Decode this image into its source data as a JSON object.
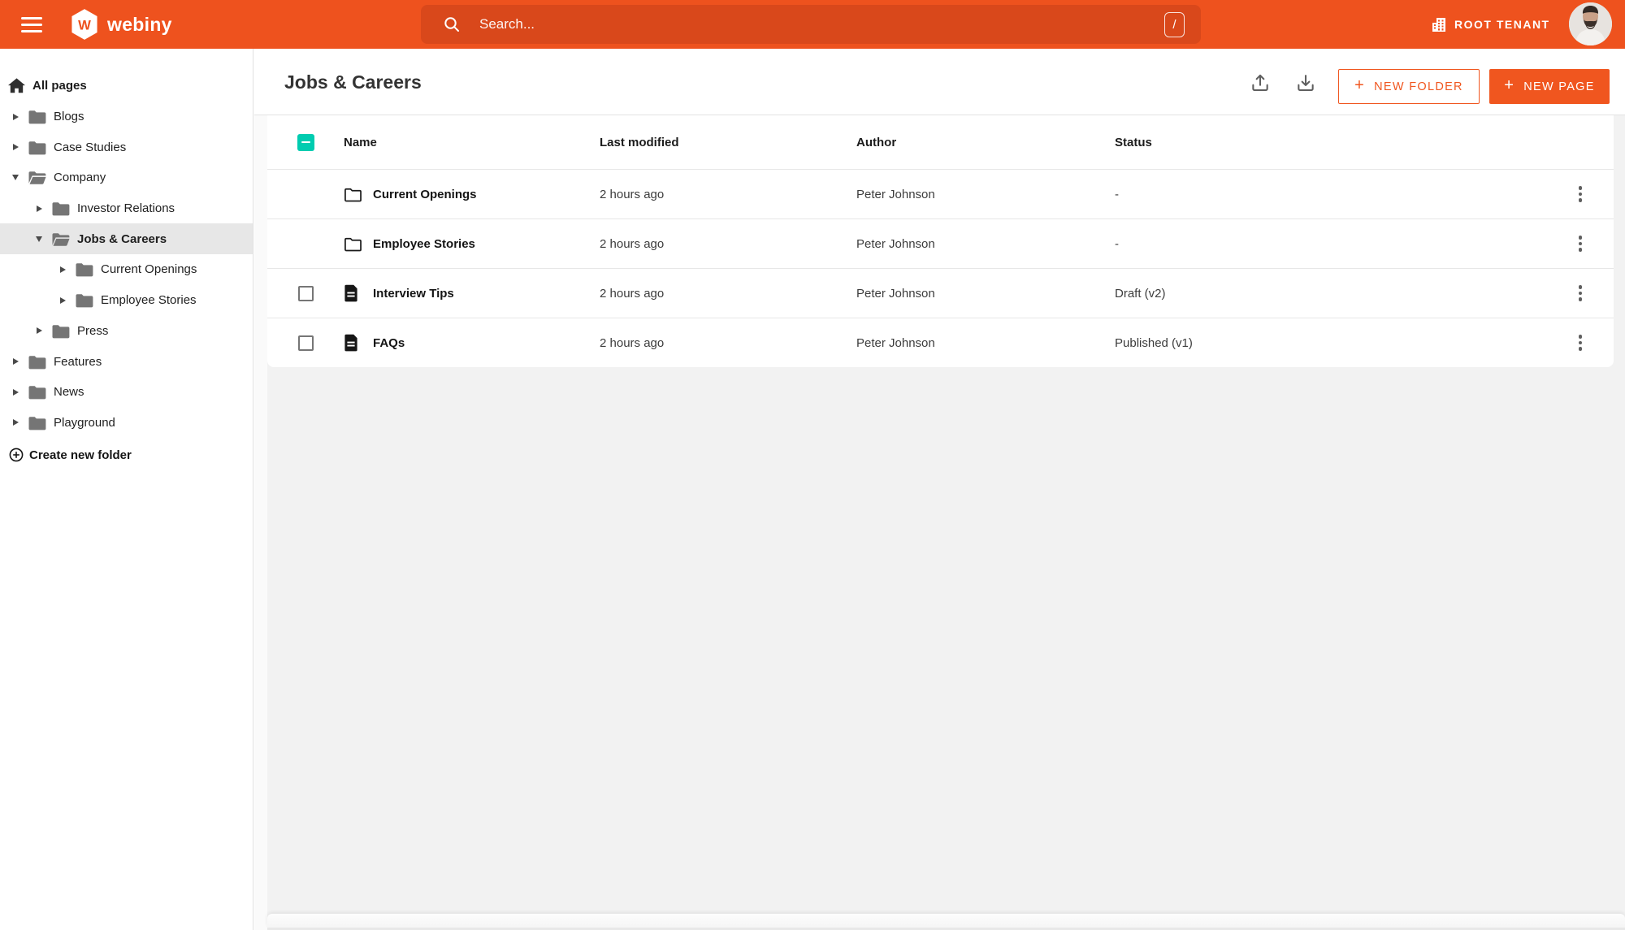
{
  "topbar": {
    "brand": "webiny",
    "search_placeholder": "Search...",
    "shortcut_key": "/",
    "tenant_label": "ROOT TENANT"
  },
  "sidebar": {
    "root_label": "All pages",
    "items": [
      {
        "label": "Blogs",
        "level": 0,
        "state": "collapsed",
        "selected": false
      },
      {
        "label": "Case Studies",
        "level": 0,
        "state": "collapsed",
        "selected": false
      },
      {
        "label": "Company",
        "level": 0,
        "state": "expanded",
        "selected": false
      },
      {
        "label": "Investor Relations",
        "level": 1,
        "state": "collapsed",
        "selected": false
      },
      {
        "label": "Jobs & Careers",
        "level": 1,
        "state": "expanded",
        "selected": true
      },
      {
        "label": "Current Openings",
        "level": 2,
        "state": "collapsed",
        "selected": false
      },
      {
        "label": "Employee Stories",
        "level": 2,
        "state": "collapsed",
        "selected": false
      },
      {
        "label": "Press",
        "level": 1,
        "state": "collapsed",
        "selected": false
      },
      {
        "label": "Features",
        "level": 0,
        "state": "collapsed",
        "selected": false
      },
      {
        "label": "News",
        "level": 0,
        "state": "collapsed",
        "selected": false
      },
      {
        "label": "Playground",
        "level": 0,
        "state": "collapsed",
        "selected": false
      }
    ],
    "create_folder_label": "Create new folder"
  },
  "main": {
    "title": "Jobs & Careers",
    "actions": {
      "new_folder_label": "NEW FOLDER",
      "new_page_label": "NEW PAGE"
    },
    "table": {
      "headers": [
        "Name",
        "Last modified",
        "Author",
        "Status"
      ],
      "header_checkbox_state": "indeterminate",
      "rows": [
        {
          "type": "folder",
          "name": "Current Openings",
          "modified": "2 hours ago",
          "author": "Peter Johnson",
          "status": "-"
        },
        {
          "type": "folder",
          "name": "Employee Stories",
          "modified": "2 hours ago",
          "author": "Peter Johnson",
          "status": "-"
        },
        {
          "type": "page",
          "name": "Interview Tips",
          "modified": "2 hours ago",
          "author": "Peter Johnson",
          "status": "Draft (v2)"
        },
        {
          "type": "page",
          "name": "FAQs",
          "modified": "2 hours ago",
          "author": "Peter Johnson",
          "status": "Published (v1)"
        }
      ]
    }
  },
  "icons": {
    "plus_glyph": "+",
    "logo_letter": "W"
  },
  "colors": {
    "topbar_orange": "#ee521e",
    "search_bg": "#d9481b",
    "primary_orange": "#f0561f",
    "checkbox_teal": "#00ccb0",
    "selected_gray": "#e7e7e7",
    "panel_gray": "#f2f2f2"
  }
}
